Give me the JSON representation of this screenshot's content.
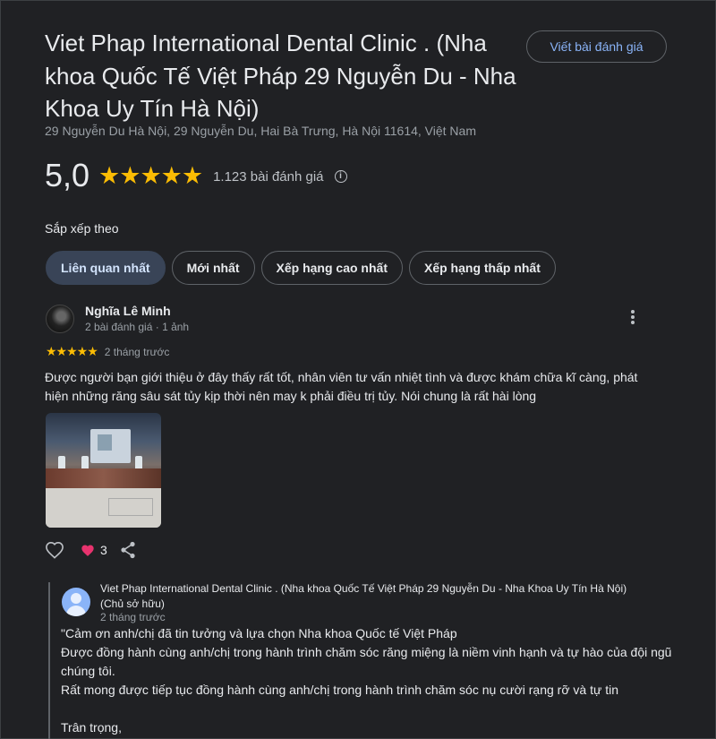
{
  "header": {
    "title": "Viet Phap International Dental Clinic . (Nha khoa Quốc Tế Việt Pháp 29 Nguyễn Du - Nha Khoa Uy Tín Hà Nội)",
    "address": "29 Nguyễn Du Hà Nội, 29 Nguyễn Du, Hai Bà Trưng, Hà Nội 11614, Việt Nam",
    "write_review_label": "Viết bài đánh giá"
  },
  "rating": {
    "score": "5,0",
    "stars": "★★★★★",
    "review_count": "1.123 bài đánh giá",
    "info_icon": "ⓘ"
  },
  "sort": {
    "label": "Sắp xếp theo",
    "options": [
      {
        "label": "Liên quan nhất",
        "active": true
      },
      {
        "label": "Mới nhất",
        "active": false
      },
      {
        "label": "Xếp hạng cao nhất",
        "active": false
      },
      {
        "label": "Xếp hạng thấp nhất",
        "active": false
      }
    ]
  },
  "review": {
    "author": "Nghĩa Lê Minh",
    "meta": "2 bài đánh giá · 1 ảnh",
    "stars": "★★★★★",
    "rating_value": 5,
    "time": "2 tháng trước",
    "text": "Được người bạn giới thiệu ở đây thấy rất tốt, nhân viên tư vấn nhiệt tình và được khám chữa kĩ càng, phát hiện những răng sâu sát tủy kịp thời nên may k phải điều trị tủy. Nói chung là rất hài lòng",
    "like_count": "3",
    "icons": {
      "like": "heart-outline-icon",
      "reaction": "heart-filled-icon",
      "share": "share-icon",
      "more": "more-vert-icon"
    },
    "reaction_color": "#e8336e"
  },
  "owner_reply": {
    "name": "Viet Phap International Dental Clinic . (Nha khoa Quốc Tế Việt Pháp 29 Nguyễn Du - Nha Khoa Uy Tín Hà Nội) (Chủ sở hữu)",
    "time": "2 tháng trước",
    "text": "\"Cảm ơn anh/chị đã tin tưởng và lựa chọn Nha khoa Quốc tế Việt Pháp\nĐược đồng hành cùng anh/chị trong hành trình chăm sóc răng miệng là niềm vinh hạnh và tự hào của đội ngũ chúng tôi.\nRất mong được tiếp tục đồng hành cùng anh/chị trong hành trình chăm sóc nụ cười rạng rỡ và tự tin\n\nTrân trọng,"
  },
  "colors": {
    "background": "#202124",
    "star": "#fbbc04",
    "accent": "#8ab4f8",
    "active_chip": "#394457"
  }
}
